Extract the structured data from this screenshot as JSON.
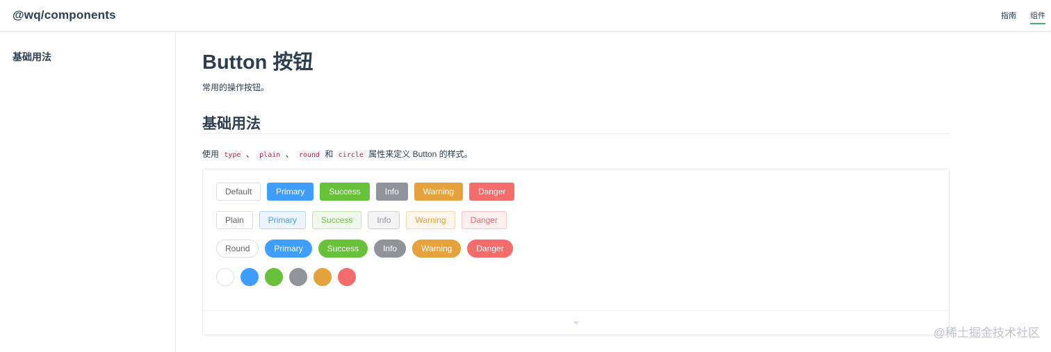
{
  "navbar": {
    "site_title": "@wq/components",
    "links": [
      {
        "label": "指南",
        "active": false
      },
      {
        "label": "组件",
        "active": true
      }
    ]
  },
  "sidebar": {
    "items": [
      {
        "label": "基础用法"
      }
    ]
  },
  "content": {
    "title": "Button 按钮",
    "description": "常用的操作按钮。",
    "section_title": "基础用法",
    "section_desc": {
      "prefix": "使用",
      "code_type": "type",
      "sep1": "、",
      "code_plain": "plain",
      "sep2": "、",
      "code_round": "round",
      "and_word": "和",
      "code_circle": "circle",
      "suffix": "属性来定义 Button 的样式。"
    }
  },
  "colors": {
    "default": "#ffffff",
    "primary": "#409eff",
    "success": "#67c23a",
    "info": "#909399",
    "warning": "#e6a23c",
    "danger": "#f56c6c",
    "accent": "#3eaf7c"
  },
  "demo": {
    "rows": [
      {
        "variant": "solid",
        "buttons": [
          {
            "type": "default",
            "label": "Default"
          },
          {
            "type": "primary",
            "label": "Primary"
          },
          {
            "type": "success",
            "label": "Success"
          },
          {
            "type": "info",
            "label": "Info"
          },
          {
            "type": "warning",
            "label": "Warning"
          },
          {
            "type": "danger",
            "label": "Danger"
          }
        ]
      },
      {
        "variant": "plain",
        "buttons": [
          {
            "type": "default",
            "label": "Plain"
          },
          {
            "type": "primary",
            "label": "Primary"
          },
          {
            "type": "success",
            "label": "Success"
          },
          {
            "type": "info",
            "label": "Info"
          },
          {
            "type": "warning",
            "label": "Warning"
          },
          {
            "type": "danger",
            "label": "Danger"
          }
        ]
      },
      {
        "variant": "round",
        "buttons": [
          {
            "type": "default",
            "label": "Round"
          },
          {
            "type": "primary",
            "label": "Primary"
          },
          {
            "type": "success",
            "label": "Success"
          },
          {
            "type": "info",
            "label": "Info"
          },
          {
            "type": "warning",
            "label": "Warning"
          },
          {
            "type": "danger",
            "label": "Danger"
          }
        ]
      },
      {
        "variant": "circle",
        "buttons": [
          {
            "type": "default",
            "label": ""
          },
          {
            "type": "primary",
            "label": ""
          },
          {
            "type": "success",
            "label": ""
          },
          {
            "type": "info",
            "label": ""
          },
          {
            "type": "warning",
            "label": ""
          },
          {
            "type": "danger",
            "label": ""
          }
        ]
      }
    ],
    "footer_icon": "caret-down-icon"
  },
  "watermark": "@稀土掘金技术社区"
}
